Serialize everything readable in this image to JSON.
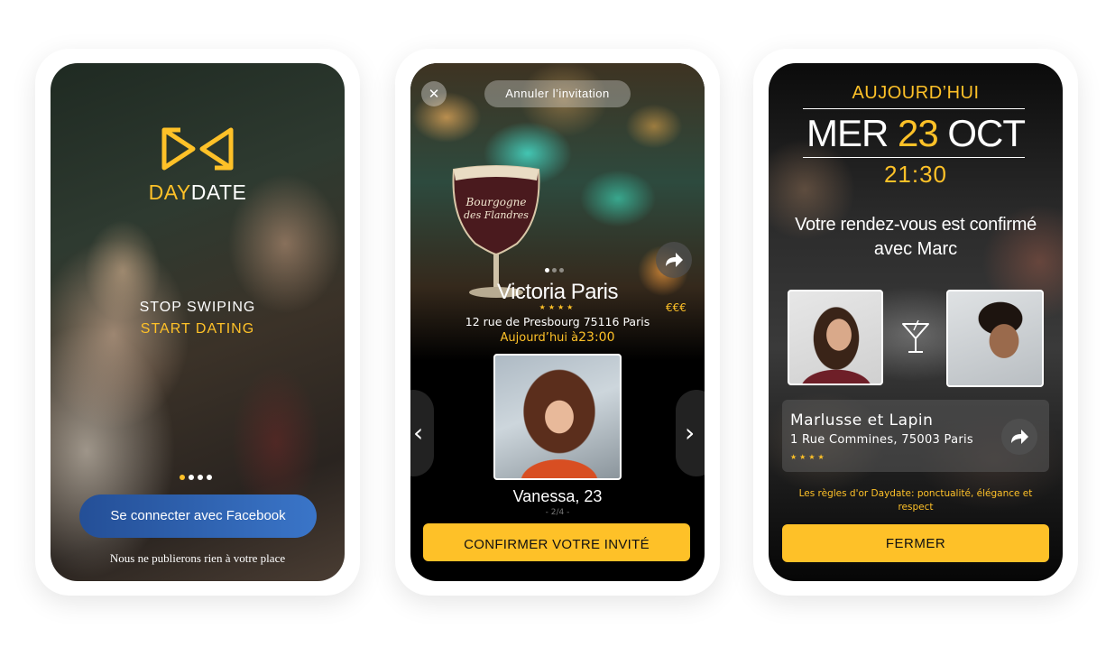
{
  "screen1": {
    "brand_day": "DAY",
    "brand_date": "DATE",
    "tagline1": "STOP SWIPING",
    "tagline2": "START DATING",
    "facebook_button": "Se connecter avec Facebook",
    "footer_note": "Nous ne publierons rien à votre place",
    "carousel": {
      "count": 4,
      "active": 1
    }
  },
  "screen2": {
    "close_label": "✕",
    "cancel_label": "Annuler l’invitation",
    "venue_name": "Victoria Paris",
    "venue_stars": "★★★★",
    "venue_price": "€€€",
    "venue_address": "12 rue de Presbourg 75116 Paris",
    "when_day": "Aujourd’hui à",
    "when_time": "23:00",
    "prev_label": "‹",
    "next_label": "›",
    "guest_name": "Vanessa, 23",
    "guest_pager": "- 2/4 -",
    "confirm_button": "CONFIRMER VOTRE INVITÉ",
    "photo_dots": {
      "count": 3,
      "active": 1
    }
  },
  "screen3": {
    "today_label": "AUJOURD’HUI",
    "date_day": "MER",
    "date_num": "23",
    "date_month": "OCT",
    "time": "21:30",
    "confirm_line1": "Votre rendez-vous est confirmé",
    "confirm_line2": "avec Marc",
    "place_name": "Marlusse et Lapin",
    "place_address": "1 Rue Commines, 75003 Paris",
    "place_stars": "★★★★",
    "rules_text": "Les règles d'or Daydate: ponctualité, élégance et respect",
    "close_button": "FERMER"
  },
  "colors": {
    "accent": "#fec128",
    "facebook_start": "#244f97",
    "facebook_end": "#3a75c8"
  }
}
